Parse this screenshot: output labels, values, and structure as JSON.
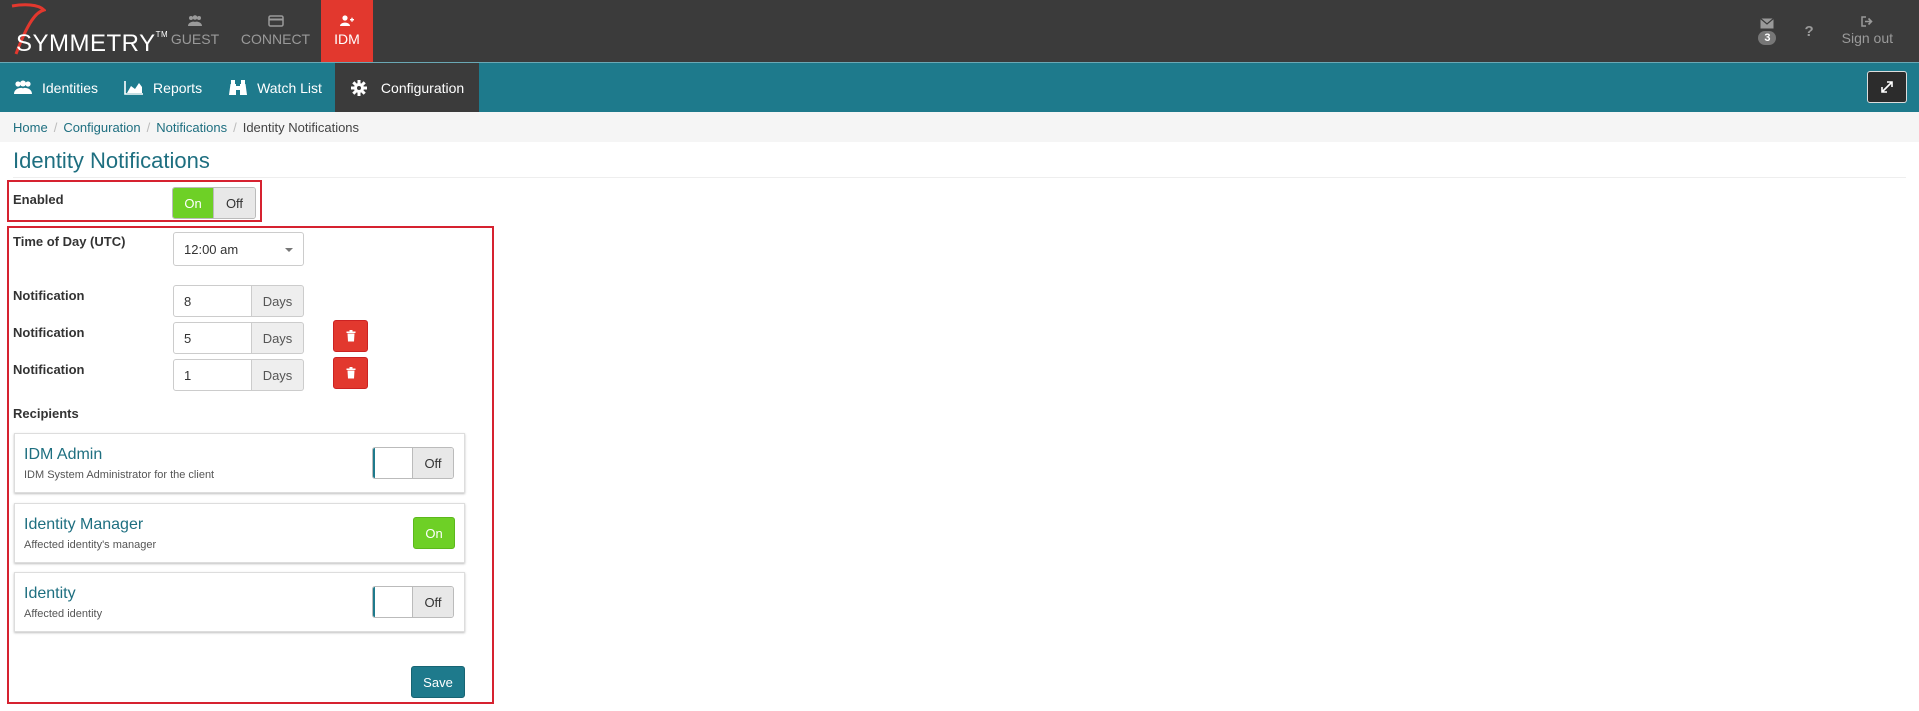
{
  "brand": {
    "name": "SYMMETRY",
    "tm": "TM"
  },
  "topnav": [
    {
      "label": "GUEST",
      "icon": "guest-icon"
    },
    {
      "label": "CONNECT",
      "icon": "card-icon"
    },
    {
      "label": "IDM",
      "icon": "user-add-icon",
      "active": true
    }
  ],
  "topright": {
    "messages_count": "3",
    "help": "?",
    "signout": "Sign out"
  },
  "subnav": [
    {
      "label": "Identities",
      "icon": "users-icon"
    },
    {
      "label": "Reports",
      "icon": "area-chart-icon"
    },
    {
      "label": "Watch List",
      "icon": "binoculars-icon"
    },
    {
      "label": "Configuration",
      "icon": "gear-icon",
      "active": true
    }
  ],
  "breadcrumb": {
    "home": "Home",
    "configuration": "Configuration",
    "notifications": "Notifications",
    "current": "Identity Notifications"
  },
  "page": {
    "title": "Identity Notifications"
  },
  "enabled": {
    "label": "Enabled",
    "on": "On",
    "off": "Off"
  },
  "time_of_day": {
    "label": "Time of Day (UTC)",
    "value": "12:00 am"
  },
  "notifications": [
    {
      "label": "Notification",
      "value": "8",
      "unit": "Days"
    },
    {
      "label": "Notification",
      "value": "5",
      "unit": "Days"
    },
    {
      "label": "Notification",
      "value": "1",
      "unit": "Days"
    }
  ],
  "recipients": {
    "label": "Recipients",
    "items": [
      {
        "name": "IDM Admin",
        "desc": "IDM System Administrator for the client",
        "state": "Off"
      },
      {
        "name": "Identity Manager",
        "desc": "Affected identity's manager",
        "state": "On"
      },
      {
        "name": "Identity",
        "desc": "Affected identity",
        "state": "Off"
      }
    ]
  },
  "save_label": "Save",
  "colors": {
    "accent": "#1e7a8c",
    "danger": "#e2382e",
    "success": "#6ed026",
    "highlight": "#d62230",
    "topbar": "#3b3b3b"
  }
}
